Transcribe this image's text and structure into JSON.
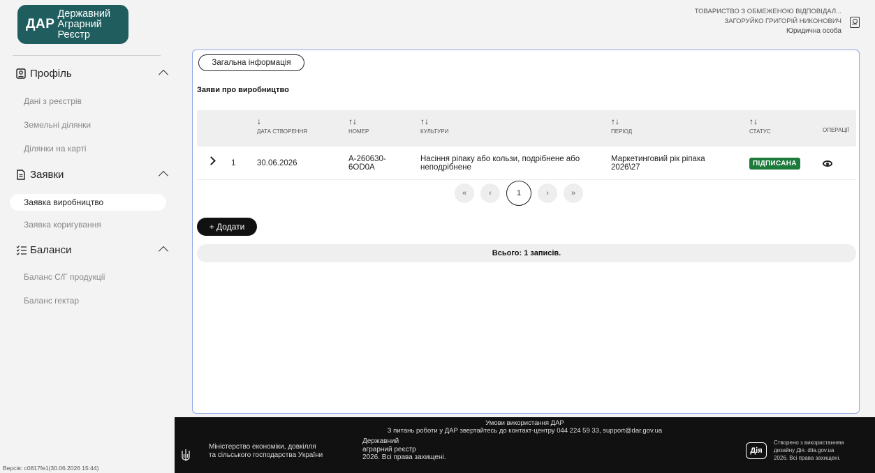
{
  "header": {
    "logo_mark": "ДАР",
    "logo_line1": "Державний",
    "logo_line2": "Аграрний",
    "logo_line3": "Реєстр",
    "org": "ТОВАРИСТВО З ОБМЕЖЕНОЮ ВІДПОВІДАЛ...",
    "person": "ЗАГОРУЙКО ГРИГОРІЙ НИКОНОВИЧ",
    "role": "Юридична особа"
  },
  "sidebar": {
    "sections": [
      {
        "label": "Профіль",
        "icon": "profile-icon"
      },
      {
        "label": "Заявки",
        "icon": "document-icon"
      },
      {
        "label": "Баланси",
        "icon": "checklist-icon"
      }
    ],
    "items": [
      {
        "label": "Дані з реєстрів"
      },
      {
        "label": "Земельні ділянки"
      },
      {
        "label": "Ділянки на карті"
      },
      {
        "label": "Заявка виробництво"
      },
      {
        "label": "Заявка коригування"
      },
      {
        "label": "Баланс С/Г продукції"
      },
      {
        "label": "Баланс гектар"
      }
    ],
    "version": "Версія: c0817fe1(30.06.2026 15:44)"
  },
  "main": {
    "tab_label": "Загальна інформація",
    "section_title": "Заяви про виробництво",
    "columns": [
      "ДАТА СТВОРЕННЯ",
      "НОМЕР",
      "КУЛЬТУРИ",
      "ПЕРІОД",
      "СТАТУС",
      "ОПЕРАЦІЇ"
    ],
    "sort_icons": {
      "date": "↓",
      "other": "↑↓"
    },
    "row": {
      "index": "1",
      "date": "30.06.2026",
      "number_line1": "A-260630-",
      "number_line2": "6OD0A",
      "crop_line1": "Насіння ріпаку або кользи, подрібнене або",
      "crop_line2": "неподрібнене",
      "period_line1": "Маркетинговий рік ріпака",
      "period_line2": "2026\\27",
      "status": "ПІДПИСАНА",
      "status_color": "#1c7a3a"
    },
    "pager": {
      "first": "«",
      "prev": "‹",
      "current": "1",
      "next": "›",
      "last": "»"
    },
    "add_label": "+ Додати",
    "total": "Всього: 1 записів."
  },
  "footer": {
    "terms": "Умови використання ДАР",
    "support": "З питань роботи у ДАР звертайтесь до контакт-центру 044 224 59 33, support@dar.gov.ua",
    "ministry_line1": "Міністерство економіки, довкілля",
    "ministry_line2": "та сільського господарства України",
    "dar_line1": "Державний",
    "dar_line2": "аграрний реєстр",
    "dar_line3": "2026. Всі права захищені.",
    "diia_logo": "Дія",
    "diia_line1": "Створено з використанням",
    "diia_line2": "дизайну Дія. diia.gov.ua",
    "diia_line3": "2026. Всі права захищені."
  }
}
